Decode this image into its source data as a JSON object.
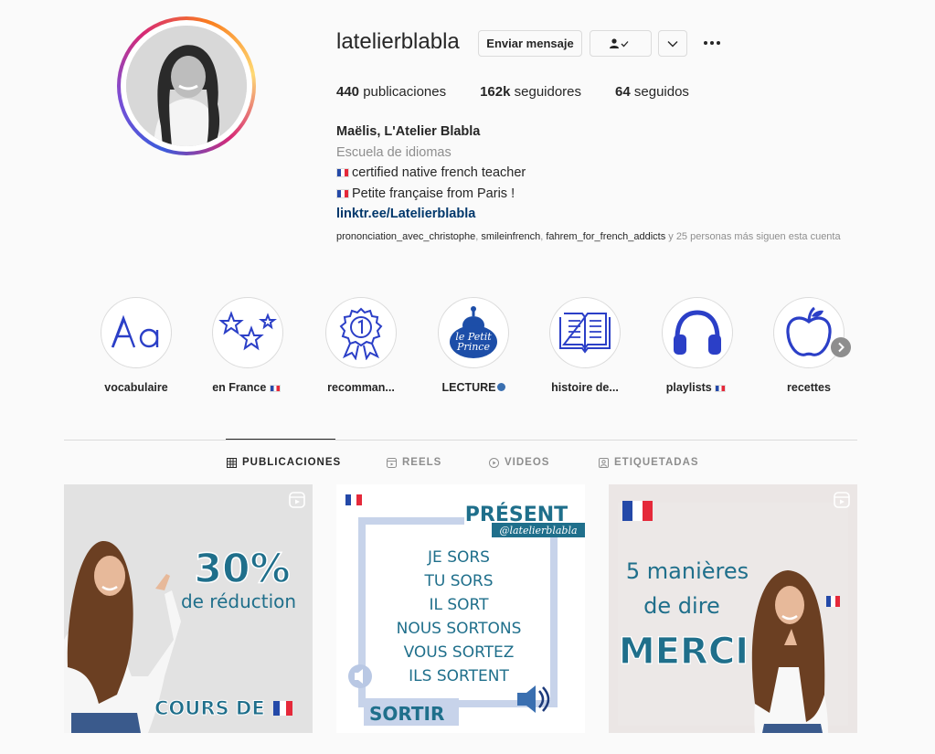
{
  "profile": {
    "username": "latelierblabla",
    "message_button": "Enviar mensaje",
    "stats": {
      "posts_count": "440",
      "posts_label": " publicaciones",
      "followers_count": "162k",
      "followers_label": " seguidores",
      "following_count": "64",
      "following_label": " seguidos"
    },
    "bio": {
      "name": "Maëlis, L'Atelier Blabla",
      "category": "Escuela de idiomas",
      "line1": "certified native french teacher",
      "line2": "Petite française from Paris !",
      "link": "linktr.ee/Latelierblabla"
    },
    "followed_by": {
      "user1": "prononciation_avec_christophe",
      "user2": "smileinfrench",
      "user3": "fahrem_for_french_addicts",
      "rest": " y 25 personas más siguen esta cuenta"
    }
  },
  "highlights": [
    {
      "label": "vocabulaire",
      "icon": "letters-aa-icon"
    },
    {
      "label": "en France",
      "icon": "stars-icon"
    },
    {
      "label": "recomman...",
      "icon": "award-ribbon-icon"
    },
    {
      "label": "LECTURE",
      "icon": "petit-prince-icon"
    },
    {
      "label": "histoire de...",
      "icon": "open-book-icon"
    },
    {
      "label": "playlists",
      "icon": "headphones-icon"
    },
    {
      "label": "recettes",
      "icon": "apple-icon"
    }
  ],
  "tabs": [
    {
      "label": "PUBLICACIONES",
      "icon": "grid-icon",
      "active": true
    },
    {
      "label": "REELS",
      "icon": "reels-icon",
      "active": false
    },
    {
      "label": "VIDEOS",
      "icon": "play-icon",
      "active": false
    },
    {
      "label": "ETIQUETADAS",
      "icon": "tag-user-icon",
      "active": false
    }
  ],
  "posts": [
    {
      "big": "30%",
      "sub": "de réduction",
      "bottom": "COURS DE"
    },
    {
      "title": "PRÉSENT",
      "handle": "@latelierblabla",
      "lines": [
        "JE SORS",
        "TU SORS",
        "IL SORT",
        "NOUS SORTONS",
        "VOUS SORTEZ",
        "ILS SORTENT"
      ],
      "verb": "SORTIR"
    },
    {
      "line1": "5 manières",
      "line2": "de dire",
      "big": "MERCI"
    }
  ],
  "colors": {
    "accent_blue": "#2b3fc7",
    "link": "#00376b",
    "teal": "#1f6f8b",
    "muted": "#8e8e8e"
  }
}
